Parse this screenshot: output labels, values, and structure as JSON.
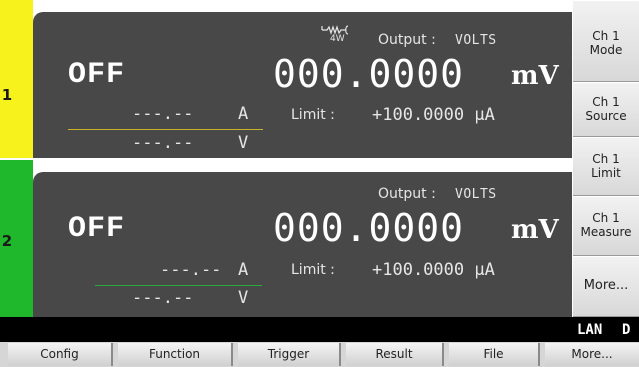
{
  "colors": {
    "channel1": "#f7f11c",
    "channel2": "#1fb82c",
    "panel": "#484848",
    "status_bar": "#000000"
  },
  "channels": [
    {
      "number": "1",
      "state": "OFF",
      "sense_icon": "4-wire-sense-icon",
      "sense_label": "4W",
      "output_label": "Output :",
      "output_mode": "VOLTS",
      "value": "000.0000",
      "unit": "mV",
      "current_reading": "---.--",
      "current_unit": "A",
      "voltage_reading": "---.--",
      "voltage_unit": "V",
      "limit_label": "Limit :",
      "limit_value": "+100.0000 µA"
    },
    {
      "number": "2",
      "state": "OFF",
      "output_label": "Output :",
      "output_mode": "VOLTS",
      "value": "000.0000",
      "unit": "mV",
      "current_reading": "---.--",
      "current_unit": "A",
      "voltage_reading": "---.--",
      "voltage_unit": "V",
      "limit_label": "Limit :",
      "limit_value": "+100.0000 µA"
    }
  ],
  "softkeys": [
    {
      "line1": "Ch 1",
      "line2": "Mode"
    },
    {
      "line1": "Ch 1",
      "line2": "Source"
    },
    {
      "line1": "Ch 1",
      "line2": "Limit"
    },
    {
      "line1": "Ch 1",
      "line2": "Measure"
    },
    {
      "line1": "More...",
      "line2": ""
    }
  ],
  "status": {
    "lan": "LAN",
    "indicator": "D"
  },
  "menu": [
    "Config",
    "Function",
    "Trigger",
    "Result",
    "File",
    "More..."
  ]
}
